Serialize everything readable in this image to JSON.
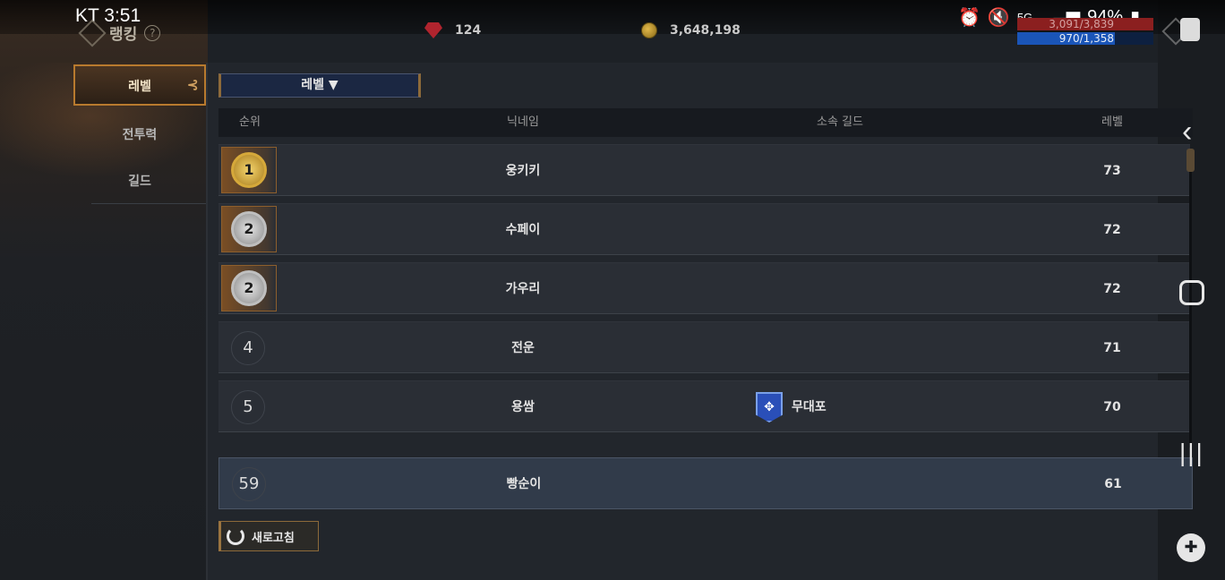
{
  "status_bar": {
    "carrier_time": "KT 3:51",
    "battery": "94%",
    "network": "5G"
  },
  "header": {
    "title": "랭킹",
    "help": "?",
    "gems": "124",
    "gold": "3,648,198",
    "hp_bar": "3,091/3,839",
    "mp_bar": "970/1,358",
    "mp_fraction": 0.714
  },
  "sidebar": {
    "tabs": [
      {
        "label": "레벨",
        "active": true
      },
      {
        "label": "전투력",
        "active": false
      },
      {
        "label": "길드",
        "active": false
      }
    ]
  },
  "filter": {
    "label": "레벨 ▼"
  },
  "table": {
    "headers": {
      "rank": "순위",
      "nickname": "닉네임",
      "guild": "소속 길드",
      "level": "레벨"
    },
    "rows": [
      {
        "rank": "1",
        "nickname": "웅키키",
        "guild": "",
        "level": "73"
      },
      {
        "rank": "2",
        "nickname": "수페이",
        "guild": "",
        "level": "72"
      },
      {
        "rank": "2",
        "nickname": "가우리",
        "guild": "",
        "level": "72"
      },
      {
        "rank": "4",
        "nickname": "전운",
        "guild": "",
        "level": "71"
      },
      {
        "rank": "5",
        "nickname": "용쌈",
        "guild": "무대포",
        "level": "70"
      }
    ],
    "my_row": {
      "rank": "59",
      "nickname": "빵순이",
      "guild": "",
      "level": "61"
    }
  },
  "refresh_button": {
    "label": "새로고침"
  },
  "colors": {
    "accent": "#b87a2e",
    "panel": "#2a2e35",
    "my_row": "#313b4a"
  }
}
